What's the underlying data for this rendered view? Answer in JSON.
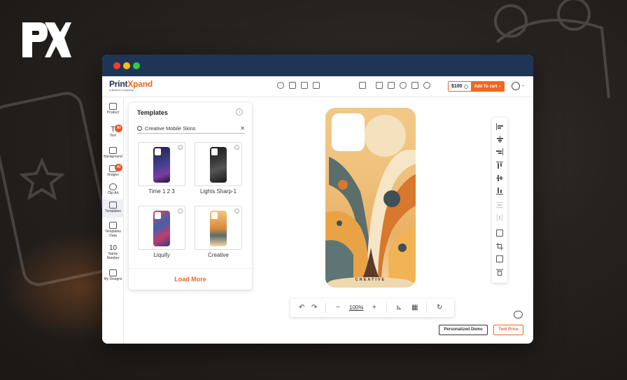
{
  "background": {
    "logo_text": "PX"
  },
  "window": {
    "controls": [
      "close",
      "minimize",
      "maximize"
    ]
  },
  "header": {
    "brand": "PrintXpand",
    "brand_part1": "Print",
    "brand_part2": "Xpand",
    "brand_sub": "A Biztech Company",
    "price": "$100",
    "add_to_cart": "Add To cart",
    "left_tools": [
      "undo-history-icon",
      "layers-icon",
      "qr-icon",
      "duplicate-icon"
    ],
    "right_tools": [
      "fullscreen-icon",
      "download-icon",
      "save-icon",
      "share-icon",
      "preview-icon",
      "3d-view-icon"
    ]
  },
  "rail": {
    "items": [
      {
        "label": "Product",
        "icon": "box-icon"
      },
      {
        "label": "Text",
        "icon": "text-icon",
        "badge": "AI"
      },
      {
        "label": "Background",
        "icon": "background-icon"
      },
      {
        "label": "Images",
        "icon": "image-icon",
        "badge": "AI"
      },
      {
        "label": "Clip Art",
        "icon": "clipart-icon"
      },
      {
        "label": "Templates",
        "icon": "template-icon",
        "active": true
      },
      {
        "label": "Templates Data",
        "icon": "template-data-icon"
      },
      {
        "label": "Name Number",
        "icon": "name-number-icon",
        "glyph": "10"
      },
      {
        "label": "My Designs",
        "icon": "my-designs-icon"
      }
    ]
  },
  "panel": {
    "title": "Templates",
    "search_value": "Creative Mobile Skins",
    "templates": [
      {
        "label": "Time 1 2 3"
      },
      {
        "label": "Lights Sharp-1"
      },
      {
        "label": "Liquify"
      },
      {
        "label": "Creative"
      }
    ],
    "load_more": "Load More"
  },
  "canvas": {
    "phone_text": "CREATIVE"
  },
  "bottom_toolbar": {
    "zoom": "100%"
  },
  "footer": {
    "personalized_demo": "Personalized Demo",
    "tool_price": "Tool Price"
  },
  "colors": {
    "accent": "#f26522",
    "titlebar": "#1f3556",
    "brand_dark": "#1d2b4a"
  }
}
